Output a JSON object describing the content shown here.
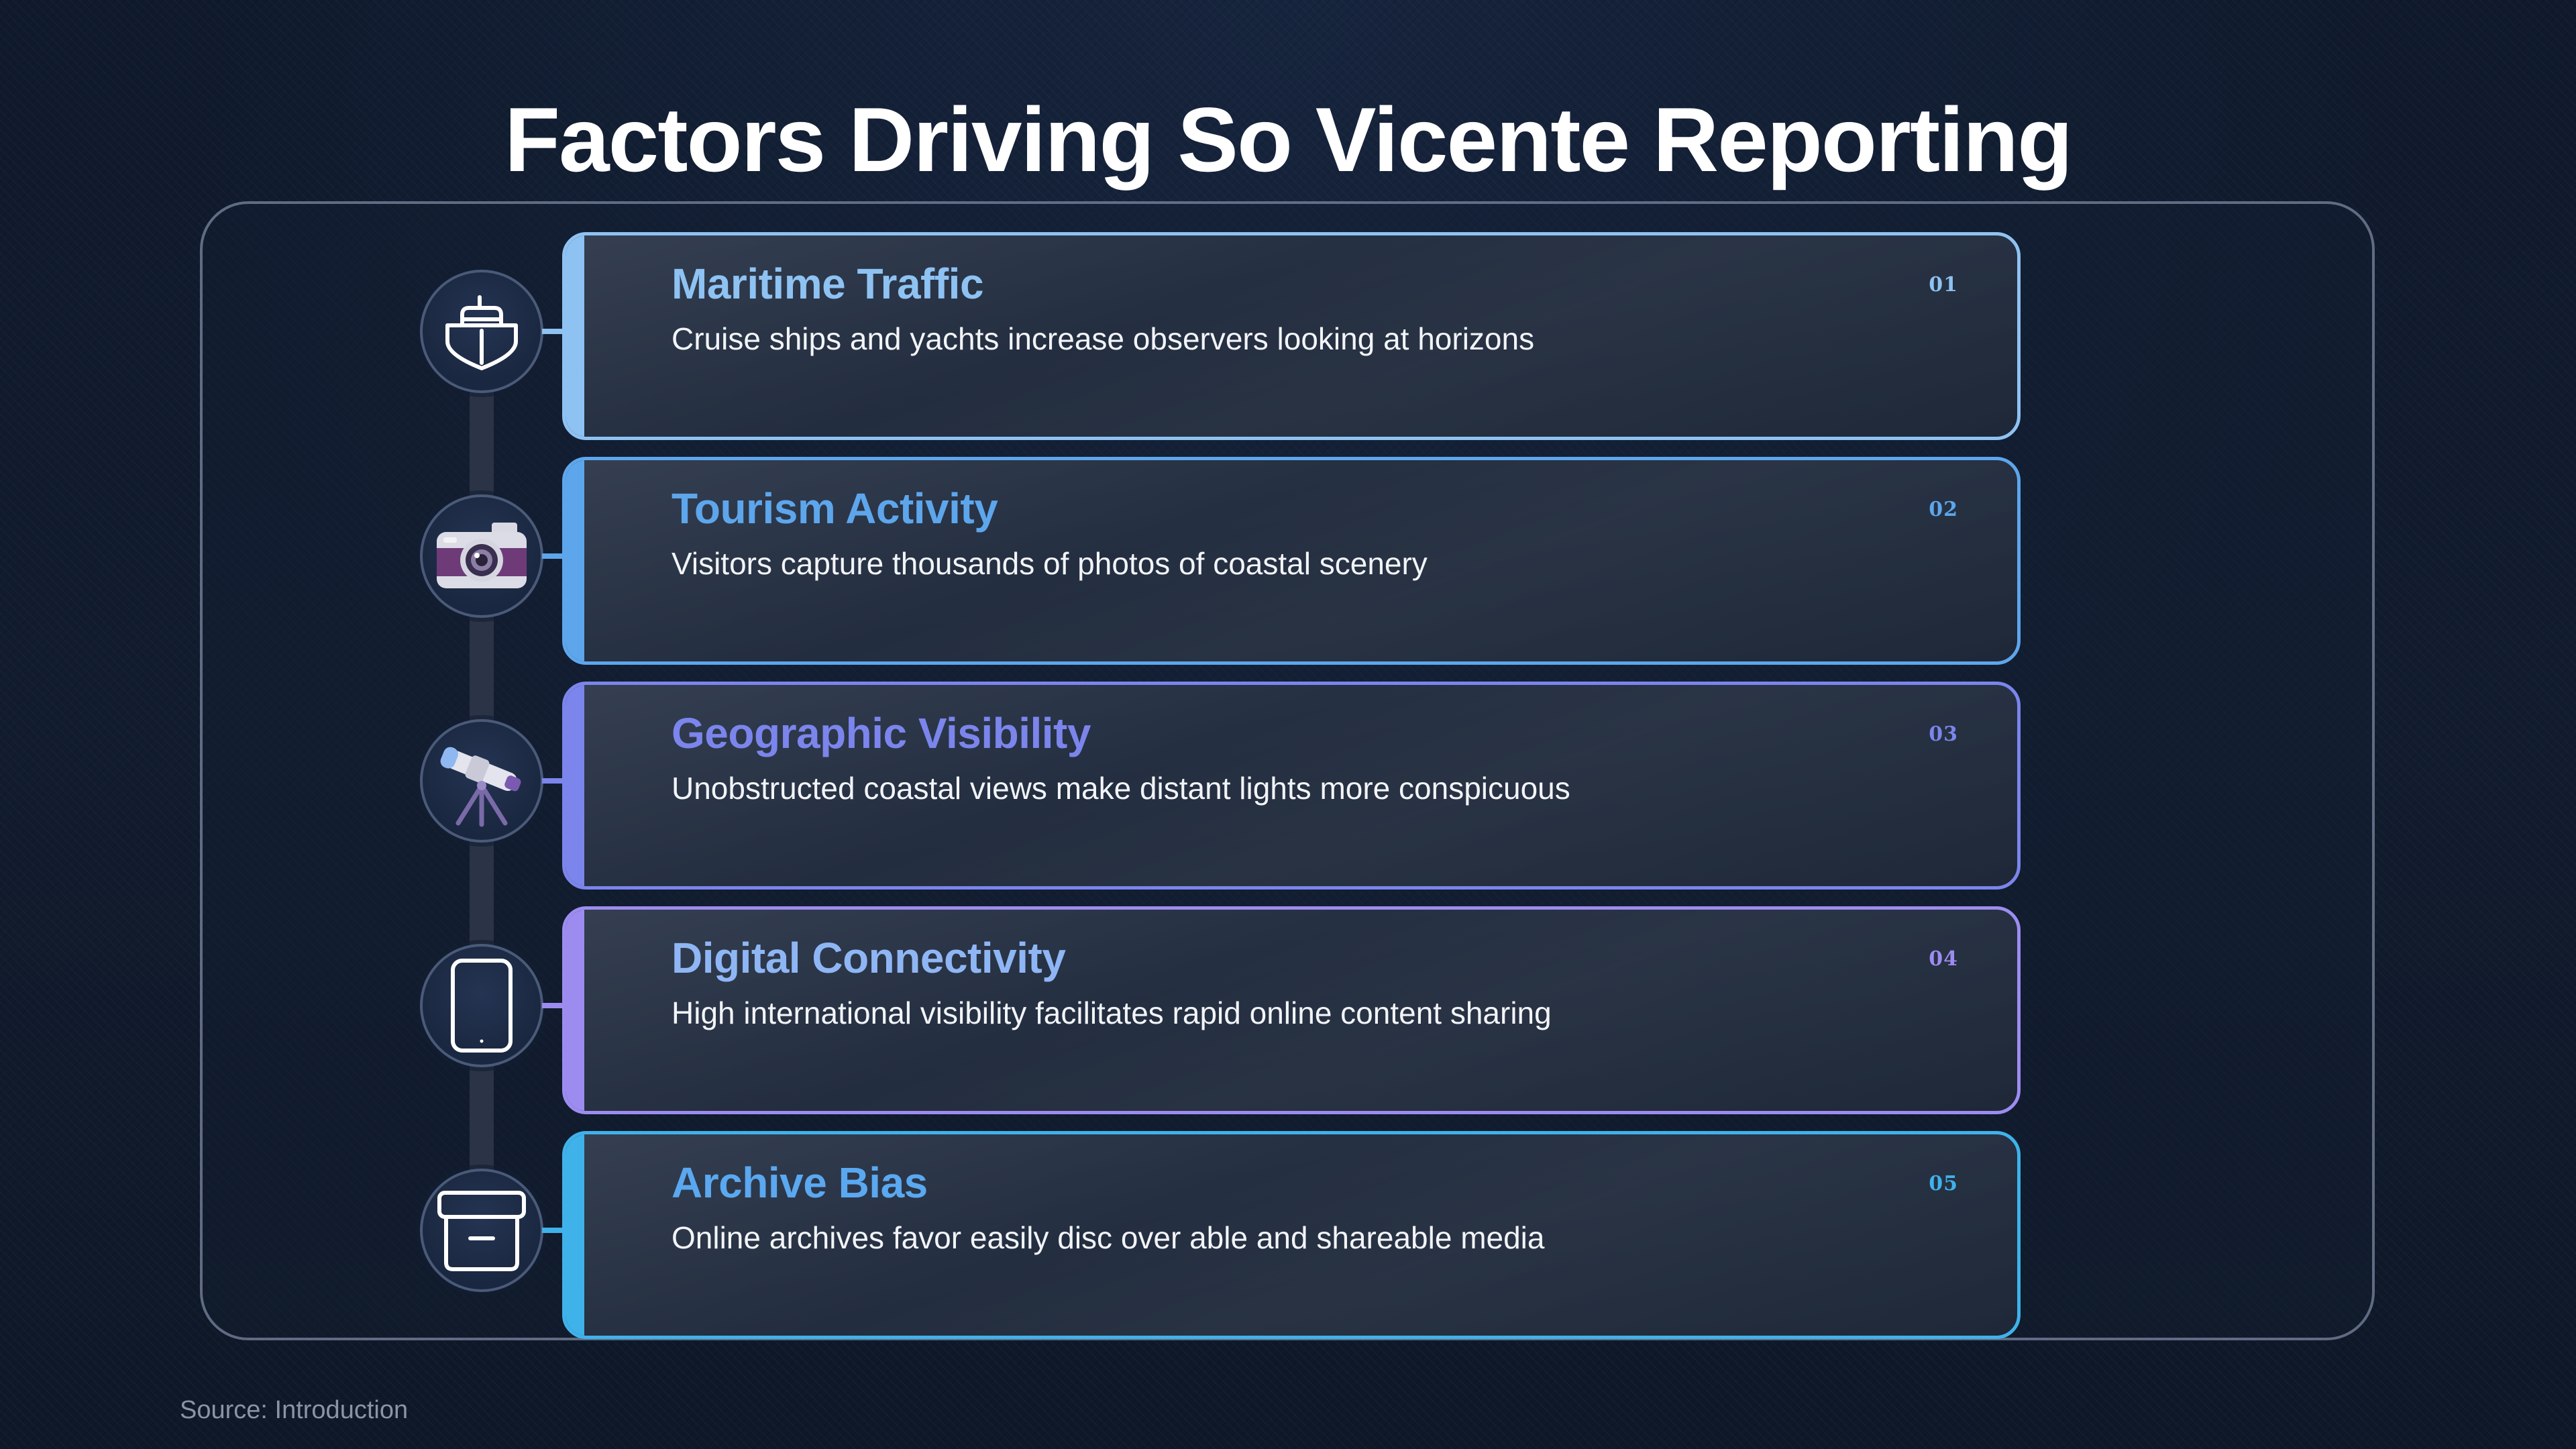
{
  "title": "Factors Driving So Vicente Reporting",
  "source": "Source: Introduction",
  "items": [
    {
      "title": "Maritime Traffic",
      "description": "Cruise ships and yachts increase observers looking at horizons",
      "number": "01",
      "icon": "ship-icon",
      "accent": "#8ec2f2"
    },
    {
      "title": "Tourism Activity",
      "description": "Visitors capture thousands of photos of coastal scenery",
      "number": "02",
      "icon": "camera-icon",
      "accent": "#5da6ec"
    },
    {
      "title": "Geographic Visibility",
      "description": "Unobstructed coastal views make distant lights more conspicuous",
      "number": "03",
      "icon": "telescope-icon",
      "accent": "#7b85ec"
    },
    {
      "title": "Digital Connectivity",
      "description": "High international visibility facilitates rapid online content sharing",
      "number": "04",
      "icon": "smartphone-icon",
      "accent": "#9d8cf0"
    },
    {
      "title": "Archive Bias",
      "description": "Online archives favor easily disc over able and shareable media",
      "number": "05",
      "icon": "archive-box-icon",
      "accent": "#3fb2ea"
    }
  ]
}
